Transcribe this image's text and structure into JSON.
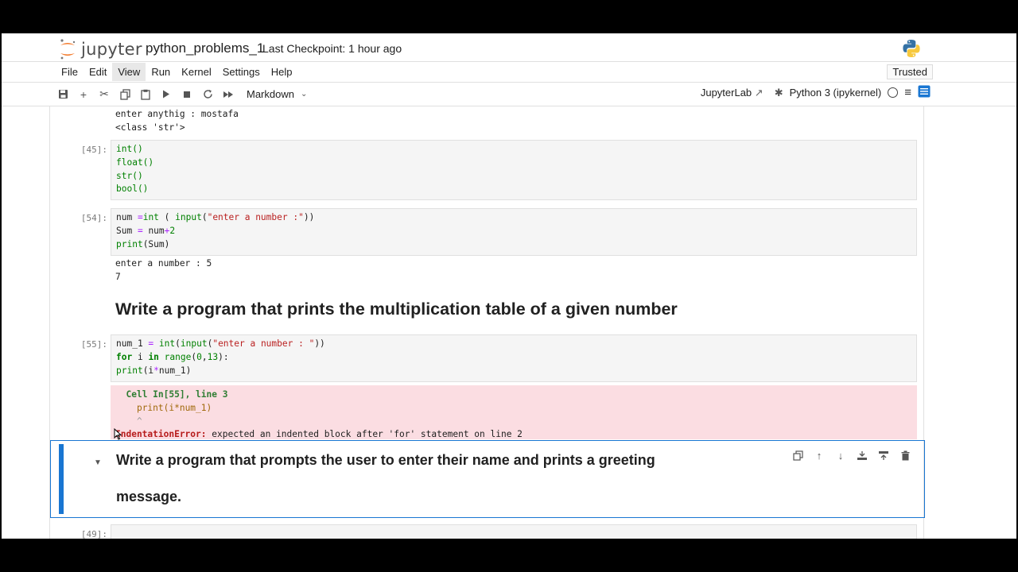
{
  "header": {
    "brand": "jupyter",
    "notebook_title": "python_problems_1",
    "checkpoint": "Last Checkpoint: 1 hour ago"
  },
  "menu": [
    "File",
    "Edit",
    "View",
    "Run",
    "Kernel",
    "Settings",
    "Help"
  ],
  "trusted": "Trusted",
  "toolbar": {
    "cell_type": "Markdown",
    "jupyterlab": "JupyterLab",
    "kernel": "Python 3 (ipykernel)"
  },
  "cells": {
    "c0_output": "enter anythig : mostafa\n<class 'str'>",
    "c45_prompt": "[45]:",
    "c54_prompt": "[54]:",
    "c54_output": "enter a number : 5\n7",
    "md1": "Write a program that prints the multiplication table of a given number",
    "c55_prompt": "[55]:",
    "err_cell": "Cell In[55], line 3",
    "err_line": "print(i*num_1)",
    "err_caret": "^",
    "err_name": "IndentationError:",
    "err_msg": " expected an indented block after 'for' statement on line 2",
    "md2_line1": "Write a program that prompts the user to enter their name and prints a greeting",
    "md2_line2": "message.",
    "c49_prompt": "[49]:"
  },
  "code45": [
    "int()",
    "float()",
    "str()",
    "bool()"
  ],
  "colors": {
    "accent": "#1976d2",
    "error_bg": "#fbdde2",
    "code_bg": "#f5f5f5"
  }
}
